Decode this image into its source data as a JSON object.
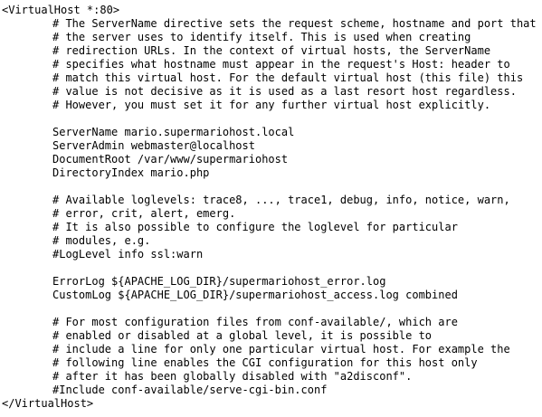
{
  "file": {
    "lines": [
      {
        "indent": false,
        "text": "<VirtualHost *:80>"
      },
      {
        "indent": true,
        "text": "# The ServerName directive sets the request scheme, hostname and port that"
      },
      {
        "indent": true,
        "text": "# the server uses to identify itself. This is used when creating"
      },
      {
        "indent": true,
        "text": "# redirection URLs. In the context of virtual hosts, the ServerName"
      },
      {
        "indent": true,
        "text": "# specifies what hostname must appear in the request's Host: header to"
      },
      {
        "indent": true,
        "text": "# match this virtual host. For the default virtual host (this file) this"
      },
      {
        "indent": true,
        "text": "# value is not decisive as it is used as a last resort host regardless."
      },
      {
        "indent": true,
        "text": "# However, you must set it for any further virtual host explicitly."
      },
      {
        "indent": false,
        "text": ""
      },
      {
        "indent": true,
        "text": "ServerName mario.supermariohost.local"
      },
      {
        "indent": true,
        "text": "ServerAdmin webmaster@localhost"
      },
      {
        "indent": true,
        "text": "DocumentRoot /var/www/supermariohost"
      },
      {
        "indent": true,
        "text": "DirectoryIndex mario.php"
      },
      {
        "indent": false,
        "text": ""
      },
      {
        "indent": true,
        "text": "# Available loglevels: trace8, ..., trace1, debug, info, notice, warn,"
      },
      {
        "indent": true,
        "text": "# error, crit, alert, emerg."
      },
      {
        "indent": true,
        "text": "# It is also possible to configure the loglevel for particular"
      },
      {
        "indent": true,
        "text": "# modules, e.g."
      },
      {
        "indent": true,
        "text": "#LogLevel info ssl:warn"
      },
      {
        "indent": false,
        "text": ""
      },
      {
        "indent": true,
        "text": "ErrorLog ${APACHE_LOG_DIR}/supermariohost_error.log"
      },
      {
        "indent": true,
        "text": "CustomLog ${APACHE_LOG_DIR}/supermariohost_access.log combined"
      },
      {
        "indent": false,
        "text": ""
      },
      {
        "indent": true,
        "text": "# For most configuration files from conf-available/, which are"
      },
      {
        "indent": true,
        "text": "# enabled or disabled at a global level, it is possible to"
      },
      {
        "indent": true,
        "text": "# include a line for only one particular virtual host. For example the"
      },
      {
        "indent": true,
        "text": "# following line enables the CGI configuration for this host only"
      },
      {
        "indent": true,
        "text": "# after it has been globally disabled with \"a2disconf\"."
      },
      {
        "indent": true,
        "text": "#Include conf-available/serve-cgi-bin.conf"
      },
      {
        "indent": false,
        "text": "</VirtualHost>"
      }
    ]
  }
}
